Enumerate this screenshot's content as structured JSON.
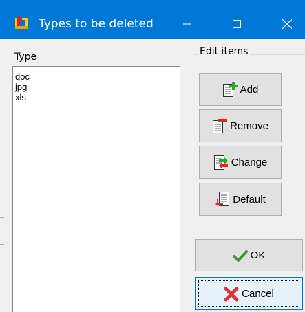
{
  "window": {
    "title": "Types to be deleted",
    "title_bar_color": "#0078d7"
  },
  "list": {
    "header": "Type",
    "items": [
      "doc",
      "jpg",
      "xls"
    ]
  },
  "edit_group": {
    "legend": "Edit items",
    "add_label": "Add",
    "remove_label": "Remove",
    "change_label": "Change",
    "default_label": "Default"
  },
  "dialog_buttons": {
    "ok_label": "OK",
    "cancel_label": "Cancel",
    "focus_color": "#0078d7"
  },
  "icons": {
    "app": "app-icon",
    "minimize": "minimize-icon",
    "maximize": "maximize-icon",
    "close": "close-icon",
    "add": "add-document-icon",
    "remove": "remove-document-icon",
    "change": "change-document-icon",
    "default": "default-document-icon",
    "ok": "checkmark-icon",
    "cancel": "cross-icon"
  }
}
